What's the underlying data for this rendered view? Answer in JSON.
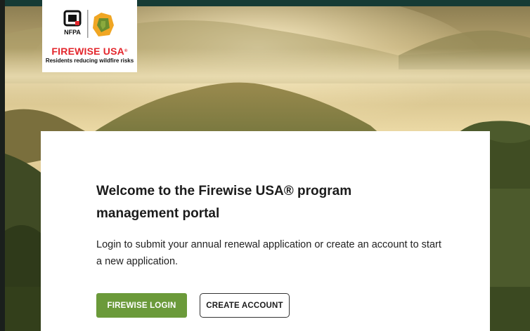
{
  "logo": {
    "org_mark": "NFPA",
    "wordmark": "FIREWISE USA",
    "wordmark_symbol": "®",
    "tagline": "Residents reducing wildfire risks"
  },
  "welcome": {
    "title": "Welcome to the Firewise USA® program management portal",
    "body": "Login to submit your annual renewal application or create an account to start a new application."
  },
  "actions": {
    "login_label": "FIREWISE LOGIN",
    "create_label": "CREATE ACCOUNT"
  },
  "colors": {
    "brand_red": "#e3262c",
    "login_green": "#6b9a3a",
    "top_bar": "#163b35"
  }
}
